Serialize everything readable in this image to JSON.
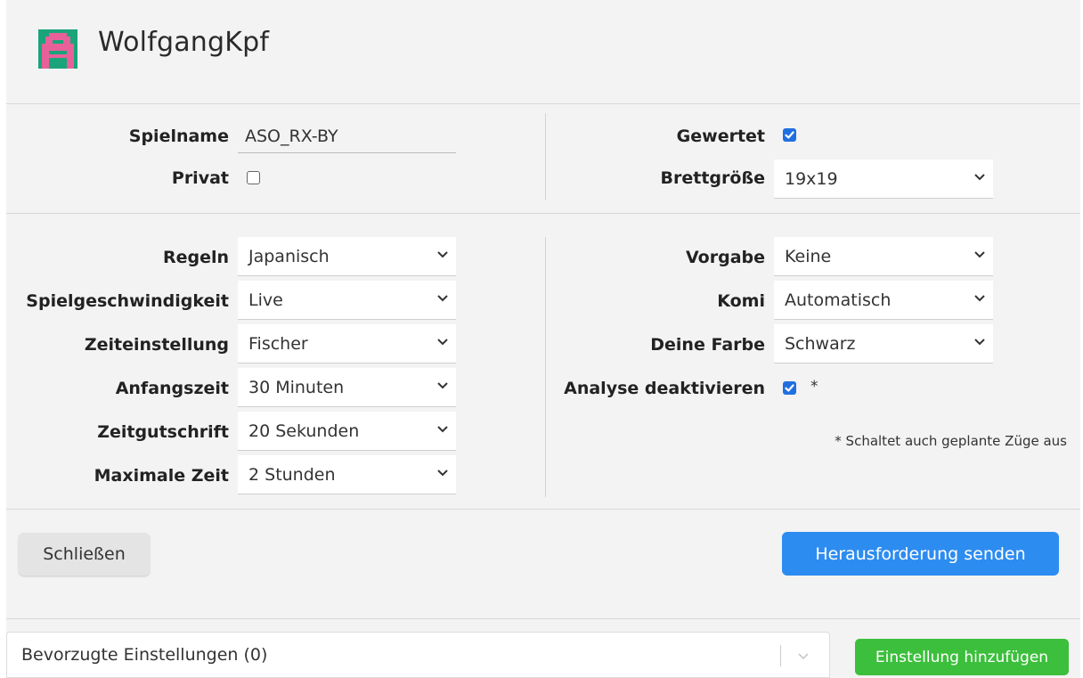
{
  "header": {
    "username": "WolfgangKpf",
    "avatar_icon": "pixel-avatar-icon"
  },
  "general": {
    "game_name_label": "Spielname",
    "game_name_value": "ASO_RX-BY",
    "private_label": "Privat",
    "private_checked": false,
    "ranked_label": "Gewertet",
    "ranked_checked": true,
    "board_size_label": "Brettgröße",
    "board_size_value": "19x19"
  },
  "settings_left": [
    {
      "label": "Regeln",
      "value": "Japanisch"
    },
    {
      "label": "Spielgeschwindigkeit",
      "value": "Live"
    },
    {
      "label": "Zeiteinstellung",
      "value": "Fischer"
    },
    {
      "label": "Anfangszeit",
      "value": "30 Minuten"
    },
    {
      "label": "Zeitgutschrift",
      "value": "20 Sekunden"
    },
    {
      "label": "Maximale Zeit",
      "value": "2 Stunden"
    }
  ],
  "settings_right": [
    {
      "label": "Vorgabe",
      "value": "Keine"
    },
    {
      "label": "Komi",
      "value": "Automatisch"
    },
    {
      "label": "Deine Farbe",
      "value": "Schwarz"
    }
  ],
  "analysis": {
    "label": "Analyse deaktivieren",
    "checked": true,
    "asterisk": "*",
    "note": "* Schaltet auch geplante Züge aus"
  },
  "buttons": {
    "close": "Schließen",
    "send": "Herausforderung senden",
    "add_setting": "Einstellung hinzufügen"
  },
  "favorites": {
    "label": "Bevorzugte Einstellungen (0)"
  },
  "colors": {
    "primary": "#2d8cf0",
    "success": "#3cbf3c",
    "checkbox": "#1f6fe0",
    "avatar_pink": "#e8609a",
    "avatar_green": "#1aa47a"
  }
}
